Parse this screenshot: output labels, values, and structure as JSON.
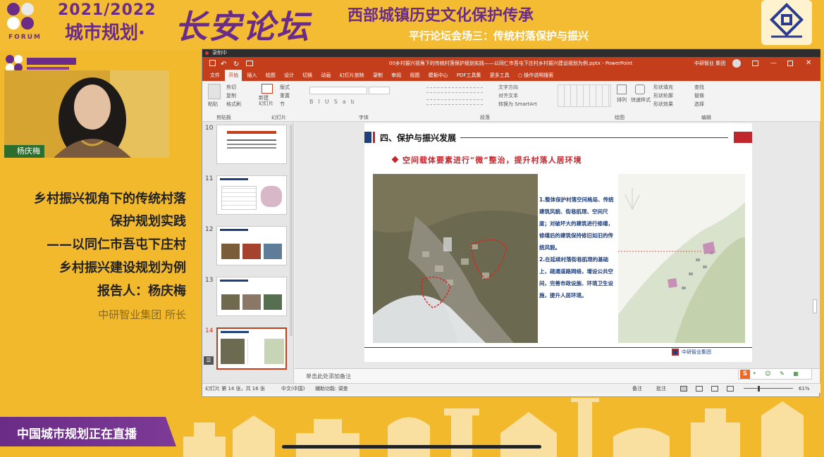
{
  "banner": {
    "logo_text": "FORUM",
    "years": "2021/2022",
    "city_planning": "城市规划·",
    "changan_forum": "长安论坛",
    "west_title": "西部城镇历史文化保护传承",
    "parallel_venue": "平行论坛会场三：传统村落保护与振兴"
  },
  "speaker": {
    "name": "杨庆梅",
    "talk_title_lines": [
      "乡村振兴视角下的传统村落",
      "保护规划实践",
      "——以同仁市吾屯下庄村",
      "乡村振兴建设规划为例",
      "报告人：杨庆梅"
    ],
    "organization": "中研智业集团 所长"
  },
  "live_banner": "中国城市规划正在直播",
  "ppt": {
    "recording_label": "录制中",
    "window_title": "00乡村振兴视角下的传统村落保护规划实践——以同仁市吾屯下庄村乡村振兴建设规划为例.pptx - PowerPoint",
    "user_org": "中研智业 集团",
    "tabs": [
      "文件",
      "开始",
      "插入",
      "绘图",
      "设计",
      "切换",
      "动画",
      "幻灯片放映",
      "录制",
      "审阅",
      "视图",
      "模板中心",
      "PDF工具集",
      "更多工具"
    ],
    "active_tab": "开始",
    "tell_me": "操作说明搜索",
    "ribbon_groups": [
      "剪贴板",
      "幻灯片",
      "字体",
      "段落",
      "绘图",
      "编辑"
    ],
    "ribbon_items": {
      "paste": "粘贴",
      "cut": "剪切",
      "copy": "复制",
      "format_painter": "格式刷",
      "new_slide": "新建\n幻灯片",
      "layout": "版式",
      "reset": "重置",
      "section": "节",
      "text_direction": "文字方向",
      "align_text": "对齐文本",
      "smartart": "转换为 SmartArt",
      "arrange": "排列",
      "quick_styles": "快速样式",
      "shape_fill": "形状填充",
      "shape_outline": "形状轮廓",
      "shape_effects": "形状效果",
      "find": "查找",
      "replace": "替换",
      "select": "选择"
    },
    "thumbnail_numbers": [
      "10",
      "11",
      "12",
      "13",
      "14"
    ],
    "selected_slide": "14",
    "slide": {
      "section_title": "四、保护与振兴发展",
      "subtitle": "空间载体要素进行“微”整治，提升村落人居环境",
      "body_text": "1.整体保护村落空间格局、传统建筑风貌、街巷肌理、空间尺度；对破坏大的建筑进行修缮，修缮后的建筑保持修旧如旧的传统风貌。\n2.在延续村落街巷肌理的基础上，疏通道路网络，增设公共空间，完善市政设施、环境卫生设施，提升人居环境。",
      "footer_logo": "中研智业集团"
    },
    "notes_placeholder": "单击此处添加备注",
    "status": {
      "slide_pos": "幻灯片 第 14 张，共 16 张",
      "language": "中文(中国)",
      "accessibility": "辅助功能: 调查",
      "notes_btn": "备注",
      "comments_btn": "批注",
      "zoom": "61%"
    }
  },
  "colors": {
    "banner_yellow": "#f3bc33",
    "purple": "#6a2c86",
    "ppt_red": "#c43e1c",
    "slide_blue": "#1f3f7a",
    "slide_red": "#c0272d"
  }
}
